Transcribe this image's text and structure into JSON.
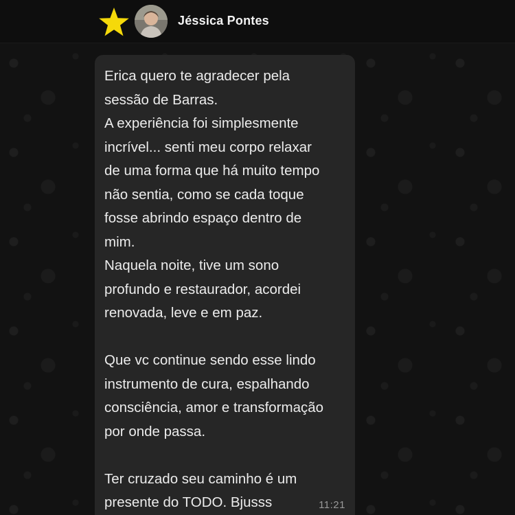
{
  "header": {
    "contact_name": "Jéssica Pontes"
  },
  "message": {
    "lines": [
      "Erica quero te agradecer pela",
      "sessão de Barras.",
      "A experiência foi simplesmente",
      "incrível... senti meu corpo relaxar",
      "de uma forma que há muito tempo",
      "não sentia, como se cada toque",
      "fosse abrindo espaço dentro de",
      "mim.",
      "Naquela noite, tive um sono",
      "profundo e restaurador, acordei",
      "renovada, leve e em paz.",
      "",
      "Que vc continue sendo esse lindo",
      "instrumento de cura, espalhando",
      "consciência, amor e transformação",
      "por onde passa.",
      "",
      "Ter cruzado seu caminho é um",
      "presente do TODO. Bjusss"
    ],
    "time": "11:21"
  },
  "colors": {
    "star": "#f5d90a",
    "bubble": "#262626",
    "text": "#ececec",
    "timestamp": "#9a9a9a"
  }
}
